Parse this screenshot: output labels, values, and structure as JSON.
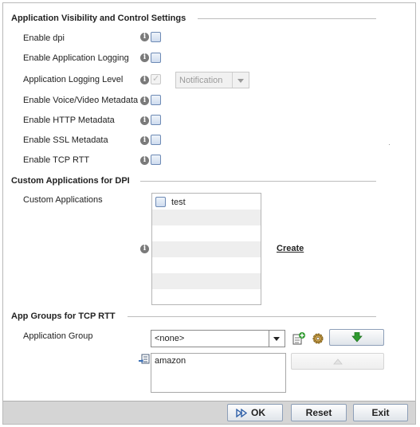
{
  "sections": {
    "visibility": "Application Visibility and Control Settings",
    "custom_apps": "Custom Applications for DPI",
    "app_groups": "App Groups for TCP RTT"
  },
  "settings": {
    "enable_dpi": "Enable dpi",
    "enable_app_logging": "Enable Application Logging",
    "app_logging_level": "Application Logging Level",
    "logging_level_value": "Notification",
    "enable_voice_video": "Enable Voice/Video Metadata",
    "enable_http": "Enable HTTP Metadata",
    "enable_ssl": "Enable SSL Metadata",
    "enable_tcp_rtt": "Enable TCP RTT"
  },
  "custom_apps": {
    "label": "Custom Applications",
    "items": [
      "test"
    ],
    "create_link": "Create"
  },
  "app_groups": {
    "label": "Application Group",
    "selected": "<none>",
    "list": [
      "amazon"
    ]
  },
  "footer": {
    "ok": "OK",
    "reset": "Reset",
    "exit": "Exit"
  },
  "info_glyph": "i",
  "colors": {
    "accent_green": "#2f9a2f",
    "checkbox_border": "#6d8ab5",
    "footer_bg": "#d5d5d5"
  }
}
